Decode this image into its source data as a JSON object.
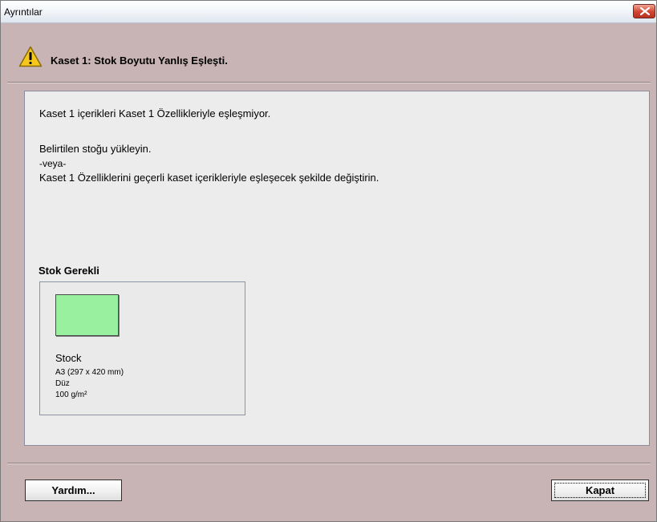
{
  "window": {
    "title": "Ayrıntılar"
  },
  "header": {
    "title": "Kaset 1: Stok Boyutu Yanlış Eşleşti.",
    "icon": "warning-icon"
  },
  "message": {
    "line1": "Kaset 1 içerikleri Kaset 1 Özellikleriyle eşleşmiyor.",
    "line2": "Belirtilen stoğu yükleyin.",
    "line3": "-veya-",
    "line4": "Kaset 1 Özelliklerini geçerli kaset içerikleriyle eşleşecek şekilde değiştirin."
  },
  "stock": {
    "heading": "Stok Gerekli",
    "name": "Stock",
    "size": "A3 (297 x 420 mm)",
    "type": "Düz",
    "weight": "100 g/m²",
    "swatch_color": "#99f19f"
  },
  "buttons": {
    "help": "Yardım...",
    "close": "Kapat"
  },
  "colors": {
    "dialog_bg": "#c8b4b4",
    "panel_bg": "#ececec",
    "close_button": "#d0452f"
  }
}
